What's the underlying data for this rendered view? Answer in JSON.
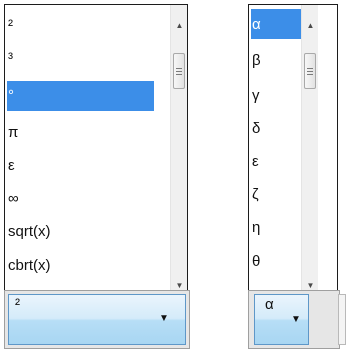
{
  "left_dropdown": {
    "items": [
      "²",
      "³",
      "°",
      "π",
      "ε",
      "∞",
      "sqrt(x)",
      "cbrt(x)"
    ],
    "selected_index": 2,
    "combo_value": "²"
  },
  "right_dropdown": {
    "items": [
      "α",
      "β",
      "γ",
      "δ",
      "ε",
      "ζ",
      "η",
      "θ"
    ],
    "selected_index": 0,
    "combo_value": "α"
  },
  "colors": {
    "selection": "#3c8ee8",
    "combo_gradient_bottom": "#a8d6f2",
    "border": "#1c1c1c"
  }
}
